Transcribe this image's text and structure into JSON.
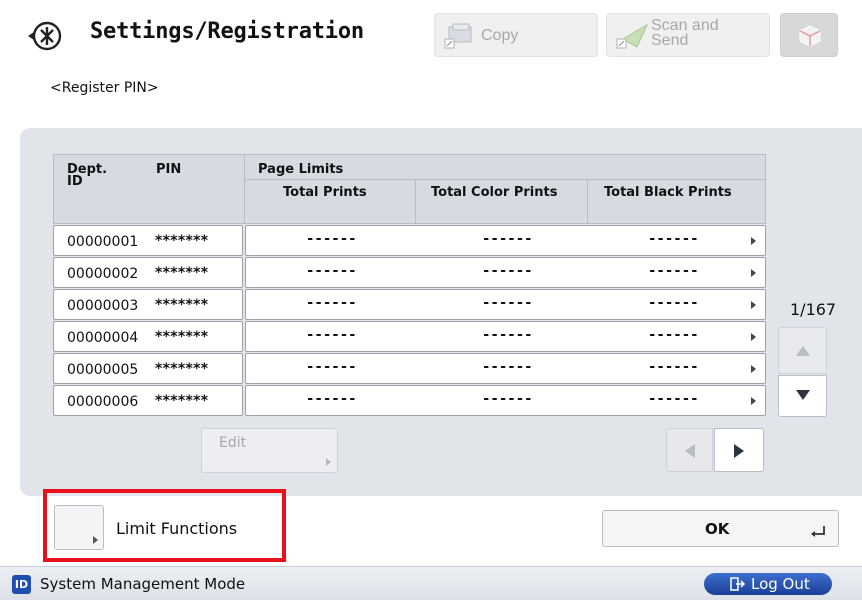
{
  "header": {
    "title": "Settings/Registration",
    "copy_label": "Copy",
    "scan_label_line1": "Scan and",
    "scan_label_line2": "Send"
  },
  "subtitle": "<Register PIN>",
  "table": {
    "col_dept_line1": "Dept.",
    "col_dept_line2": "ID",
    "col_pin": "PIN",
    "col_group": "Page Limits",
    "col_total": "Total Prints",
    "col_color": "Total Color Prints",
    "col_black": "Total Black Prints",
    "rows": [
      {
        "dept_id": "00000001",
        "pin": "*******",
        "total": "------",
        "color": "------",
        "black": "------"
      },
      {
        "dept_id": "00000002",
        "pin": "*******",
        "total": "------",
        "color": "------",
        "black": "------"
      },
      {
        "dept_id": "00000003",
        "pin": "*******",
        "total": "------",
        "color": "------",
        "black": "------"
      },
      {
        "dept_id": "00000004",
        "pin": "*******",
        "total": "------",
        "color": "------",
        "black": "------"
      },
      {
        "dept_id": "00000005",
        "pin": "*******",
        "total": "------",
        "color": "------",
        "black": "------"
      },
      {
        "dept_id": "00000006",
        "pin": "*******",
        "total": "------",
        "color": "------",
        "black": "------"
      }
    ]
  },
  "edit_label": "Edit",
  "pager": {
    "indicator": "1/167"
  },
  "limit_functions_label": "Limit Functions",
  "ok_label": "OK",
  "status": {
    "badge": "ID",
    "mode_text": "System Management Mode",
    "logout_label": "Log Out"
  },
  "colors": {
    "panel": "#e1e4e9",
    "highlight": "#e8101d",
    "logout": "#2a55b8"
  }
}
